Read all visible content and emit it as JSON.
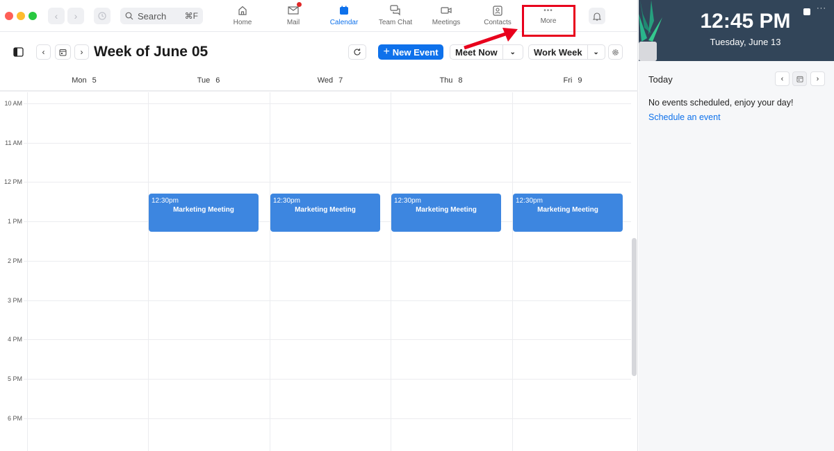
{
  "window": {
    "search": {
      "label": "Search",
      "shortcut": "⌘F",
      "icon": "search-icon"
    }
  },
  "nav_tabs": [
    {
      "label": "Home",
      "icon": "home-icon",
      "active": false
    },
    {
      "label": "Mail",
      "icon": "mail-icon",
      "active": false,
      "badge": true
    },
    {
      "label": "Calendar",
      "icon": "calendar-icon",
      "active": true
    },
    {
      "label": "Team Chat",
      "icon": "chat-icon",
      "active": false
    },
    {
      "label": "Meetings",
      "icon": "video-icon",
      "active": false
    },
    {
      "label": "Contacts",
      "icon": "contacts-icon",
      "active": false
    },
    {
      "label": "More",
      "icon": "more-dots-icon",
      "active": false,
      "highlighted": true
    }
  ],
  "toolbar": {
    "title": "Week of June 05",
    "new_event_label": "New Event",
    "meet_now_label": "Meet Now",
    "view_label": "Work Week"
  },
  "days": [
    {
      "name": "Mon",
      "num": "5"
    },
    {
      "name": "Tue",
      "num": "6"
    },
    {
      "name": "Wed",
      "num": "7"
    },
    {
      "name": "Thu",
      "num": "8"
    },
    {
      "name": "Fri",
      "num": "9"
    }
  ],
  "hours": [
    "10 AM",
    "11 AM",
    "12 PM",
    "1 PM",
    "2 PM",
    "3 PM",
    "4 PM",
    "5 PM",
    "6 PM"
  ],
  "events": [
    {
      "day": "Tue",
      "time": "12:30pm",
      "title": "Marketing Meeting"
    },
    {
      "day": "Wed",
      "time": "12:30pm",
      "title": "Marketing Meeting"
    },
    {
      "day": "Thu",
      "time": "12:30pm",
      "title": "Marketing Meeting"
    },
    {
      "day": "Fri",
      "time": "12:30pm",
      "title": "Marketing Meeting"
    }
  ],
  "side_panel": {
    "clock_time": "12:45 PM",
    "clock_date": "Tuesday, June 13",
    "today_label": "Today",
    "empty_message": "No events scheduled, enjoy your day!",
    "schedule_link": "Schedule an event"
  },
  "colors": {
    "accent": "#0e71eb",
    "event": "#3d86e0",
    "highlight": "#e8001c",
    "clock_bg": "#324559"
  }
}
